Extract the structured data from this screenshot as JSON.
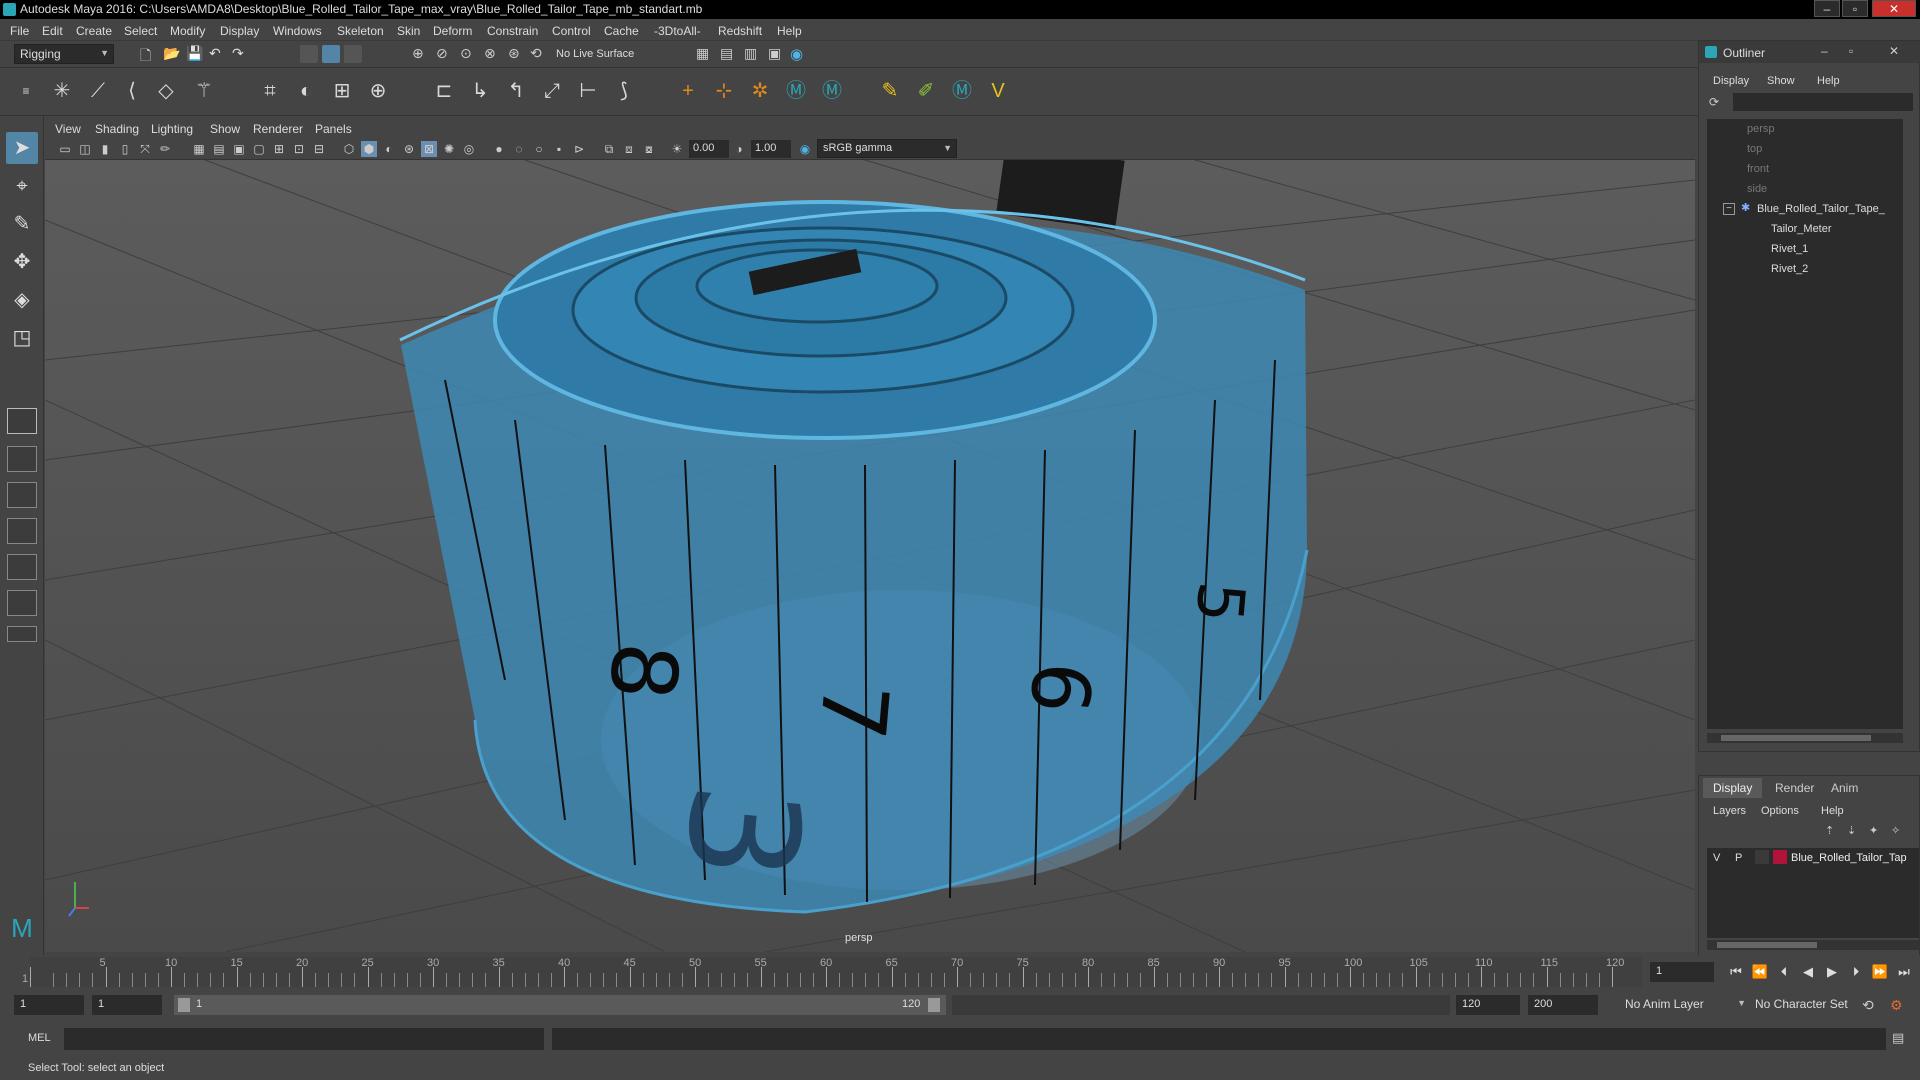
{
  "window": {
    "title": "Autodesk Maya 2016: C:\\Users\\AMDA8\\Desktop\\Blue_Rolled_Tailor_Tape_max_vray\\Blue_Rolled_Tailor_Tape_mb_standart.mb"
  },
  "menubar": [
    "File",
    "Edit",
    "Create",
    "Select",
    "Modify",
    "Display",
    "Windows",
    "Skeleton",
    "Skin",
    "Deform",
    "Constrain",
    "Control",
    "Cache",
    "-3DtoAll-",
    "Redshift",
    "Help"
  ],
  "status": {
    "menuset": "Rigging",
    "live_surface": "No Live Surface"
  },
  "viewport": {
    "menus": [
      "View",
      "Shading",
      "Lighting",
      "Show",
      "Renderer",
      "Panels"
    ],
    "exposure": "0.00",
    "gamma": "1.00",
    "colorspace": "sRGB gamma",
    "camera_label": "persp"
  },
  "outliner": {
    "title": "Outliner",
    "menus": [
      "Display",
      "Show",
      "Help"
    ],
    "items": [
      {
        "label": "persp",
        "dim": true
      },
      {
        "label": "top",
        "dim": true
      },
      {
        "label": "front",
        "dim": true
      },
      {
        "label": "side",
        "dim": true
      },
      {
        "label": "Blue_Rolled_Tailor_Tape_",
        "dim": false
      },
      {
        "label": "Tailor_Meter",
        "dim": false
      },
      {
        "label": "Rivet_1",
        "dim": false
      },
      {
        "label": "Rivet_2",
        "dim": false
      }
    ]
  },
  "layers": {
    "tabs": [
      "Display",
      "Render",
      "Anim"
    ],
    "menus": [
      "Layers",
      "Options",
      "Help"
    ],
    "layer_v": "V",
    "layer_p": "P",
    "layer_name": "Blue_Rolled_Tailor_Tap",
    "layer_color": "#b0143a"
  },
  "timeline": {
    "ticks": [
      "5",
      "10",
      "15",
      "20",
      "25",
      "30",
      "35",
      "40",
      "45",
      "50",
      "55",
      "60",
      "65",
      "70",
      "75",
      "80",
      "85",
      "90",
      "95",
      "100",
      "105",
      "110",
      "115",
      "120"
    ],
    "start_label": "1",
    "current_frame": "1"
  },
  "range": {
    "start": "1",
    "playback_start": "1",
    "slider_start": "1",
    "slider_end": "120",
    "playback_end": "120",
    "end": "200",
    "anim_layer": "No Anim Layer",
    "character_set": "No Character Set"
  },
  "cmd": {
    "mode": "MEL"
  },
  "help": {
    "text": "Select Tool: select an object"
  },
  "accent": "#5285a6"
}
